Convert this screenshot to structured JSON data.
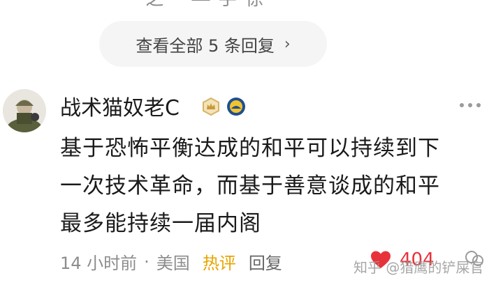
{
  "cutoff_text": "ー 之 ─ ― 手 徐",
  "view_all": {
    "label": "查看全部 5 条回复",
    "chevron": "›"
  },
  "comment": {
    "username": "战术猫奴老C",
    "content_lines": [
      "基于恐怖平衡达成的和平可以持续到下",
      "一次技术革命，而基于善意谈成的和平",
      "最多能持续一届内阁"
    ],
    "time": "14 小时前",
    "separator": "·",
    "location": "美国",
    "hot_label": "热评",
    "reply_label": "回复",
    "like_count": "404"
  },
  "watermark": "知乎 @猎鹰的铲屎官",
  "icons": {
    "avatar": "avatar-image",
    "crown": "crown-badge-icon",
    "star": "star-badge-icon",
    "more": "more-icon",
    "heart": "heart-icon",
    "share": "share-icon"
  },
  "colors": {
    "hot": "#e6a400",
    "like": "#e8323a",
    "pill_bg": "#f5f5f5"
  }
}
